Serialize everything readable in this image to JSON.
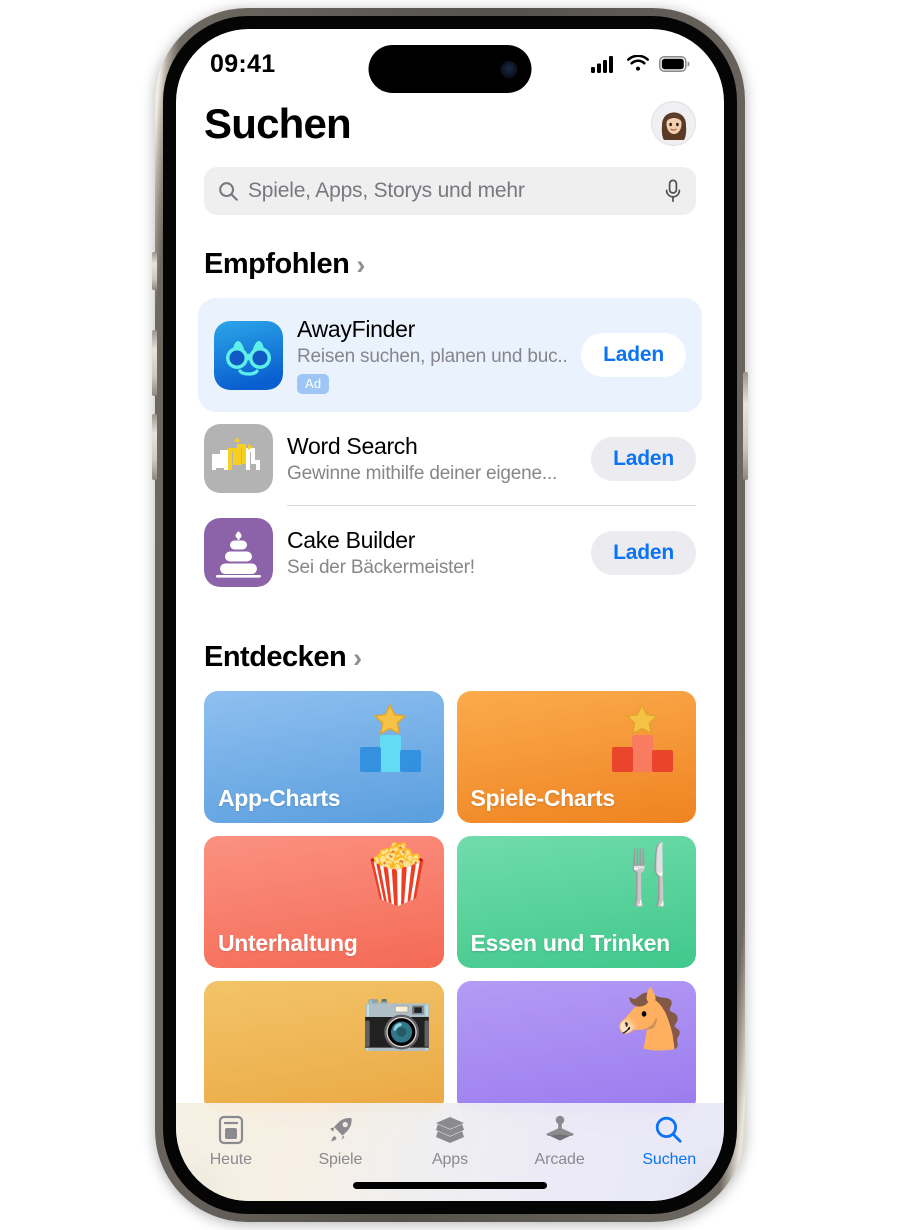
{
  "status_bar": {
    "time": "09:41",
    "icons": [
      "cellular-signal-icon",
      "wifi-icon",
      "battery-icon"
    ]
  },
  "header": {
    "title": "Suchen",
    "avatar_icon": "memoji-avatar"
  },
  "search": {
    "placeholder": "Spiele, Apps, Storys und mehr",
    "value": "",
    "search_icon": "search-icon",
    "mic_icon": "microphone-icon"
  },
  "sections": {
    "suggested": {
      "title": "Empfohlen",
      "chevron": "›",
      "apps": [
        {
          "name": "AwayFinder",
          "subtitle": "Reisen suchen, planen und buc...",
          "badge": "Ad",
          "button": "Laden",
          "icon": "awayfinder-binoculars-icon",
          "is_ad": true
        },
        {
          "name": "Word Search",
          "subtitle": "Gewinne mithilfe deiner eigene...",
          "badge": "",
          "button": "Laden",
          "icon": "word-search-icon",
          "is_ad": false
        },
        {
          "name": "Cake Builder",
          "subtitle": "Sei der Bäckermeister!",
          "badge": "",
          "button": "Laden",
          "icon": "cake-builder-icon",
          "is_ad": false
        }
      ]
    },
    "discover": {
      "title": "Entdecken",
      "chevron": "›",
      "cards": [
        {
          "label": "App-Charts",
          "color": "#74aeea",
          "art": "podium-blue-star-icon",
          "emoji": ""
        },
        {
          "label": "Spiele-Charts",
          "color": "#f59331",
          "art": "podium-red-star-icon",
          "emoji": ""
        },
        {
          "label": "Unterhaltung",
          "color": "#f87b68",
          "art": "popcorn-icon",
          "emoji": "🍿"
        },
        {
          "label": "Essen und Trinken",
          "color": "#5cd29a",
          "art": "fork-knife-glass-icon",
          "emoji": "🍴"
        },
        {
          "label": "",
          "color": "#efb659",
          "art": "camera-icon",
          "emoji": "📷"
        },
        {
          "label": "",
          "color": "#a58bf0",
          "art": "horse-icon",
          "emoji": "🐴"
        }
      ]
    }
  },
  "tab_bar": {
    "tabs": [
      {
        "label": "Heute",
        "icon": "today-card-icon",
        "active": false
      },
      {
        "label": "Spiele",
        "icon": "rocket-icon",
        "active": false
      },
      {
        "label": "Apps",
        "icon": "stack-icon",
        "active": false
      },
      {
        "label": "Arcade",
        "icon": "joystick-icon",
        "active": false
      },
      {
        "label": "Suchen",
        "icon": "search-icon",
        "active": true
      }
    ]
  },
  "colors": {
    "accent_blue": "#0a74f5",
    "ad_card_bg": "#eaf2fd",
    "ad_badge_bg": "#9ec6f5",
    "pill_bg": "#ececf0",
    "search_bg": "#efeff0",
    "subtitle_gray": "#86868b",
    "tab_inactive": "#8a8a8f"
  }
}
